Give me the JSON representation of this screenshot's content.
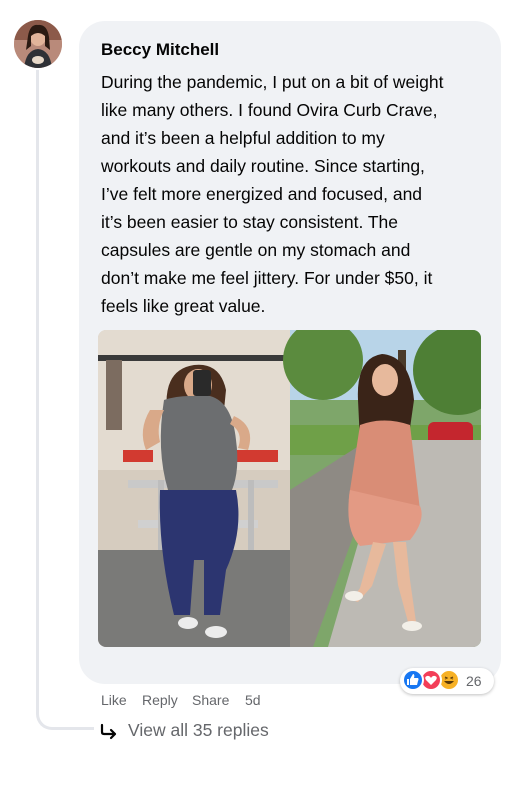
{
  "comment": {
    "author": "Beccy Mitchell",
    "text": "During the pandemic, I put on a bit of weight\nlike many others. I found Ovira Curb Crave,\nand it’s been a helpful addition to my\nworkouts and daily routine. Since starting,\nI’ve felt more energized and focused, and\nit’s been easier to stay consistent. The\ncapsules are gentle on my stomach and\ndon’t make me feel jittery. For under $50, it\nfeels like great value.",
    "avatar_icon": "user-avatar",
    "photo": "before-after-photo"
  },
  "reactions": {
    "icons": [
      "like-icon",
      "love-icon",
      "haha-icon"
    ],
    "count": "26",
    "colors": {
      "like": "#1877f2",
      "love": "#f33e58",
      "haha": "#f7b125"
    }
  },
  "actions": {
    "like": "Like",
    "reply": "Reply",
    "share": "Share",
    "time": "5d"
  },
  "replies": {
    "label": "View all 35 replies"
  }
}
